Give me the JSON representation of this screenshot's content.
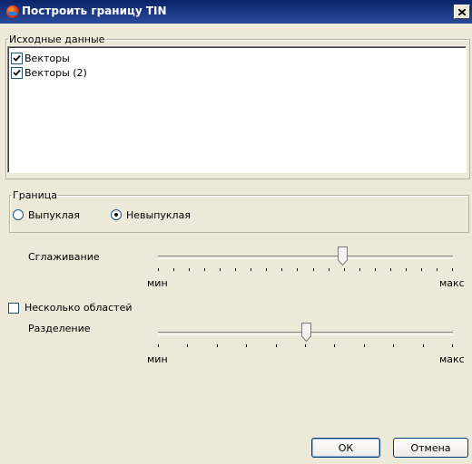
{
  "window": {
    "title": "Построить границу TIN"
  },
  "input_group": {
    "legend": "Исходные данные",
    "items": [
      {
        "label": "Векторы",
        "checked": true
      },
      {
        "label": "Векторы (2)",
        "checked": true
      }
    ]
  },
  "border_group": {
    "legend": "Граница",
    "options": [
      {
        "label": "Выпуклая",
        "selected": false
      },
      {
        "label": "Невыпуклая",
        "selected": true
      }
    ]
  },
  "smoothing": {
    "label": "Сглаживание",
    "min_label": "мин",
    "max_label": "макс",
    "value_fraction": 0.625,
    "tick_count": 20
  },
  "multiple_regions": {
    "label": "Несколько областей",
    "checked": false
  },
  "separation": {
    "label": "Разделение",
    "min_label": "мин",
    "max_label": "макс",
    "value_fraction": 0.5,
    "tick_count": 11
  },
  "buttons": {
    "ok": "ОК",
    "cancel": "Отмена"
  },
  "colors": {
    "titlebar": "#0a246a",
    "dialog": "#ece9d8"
  }
}
